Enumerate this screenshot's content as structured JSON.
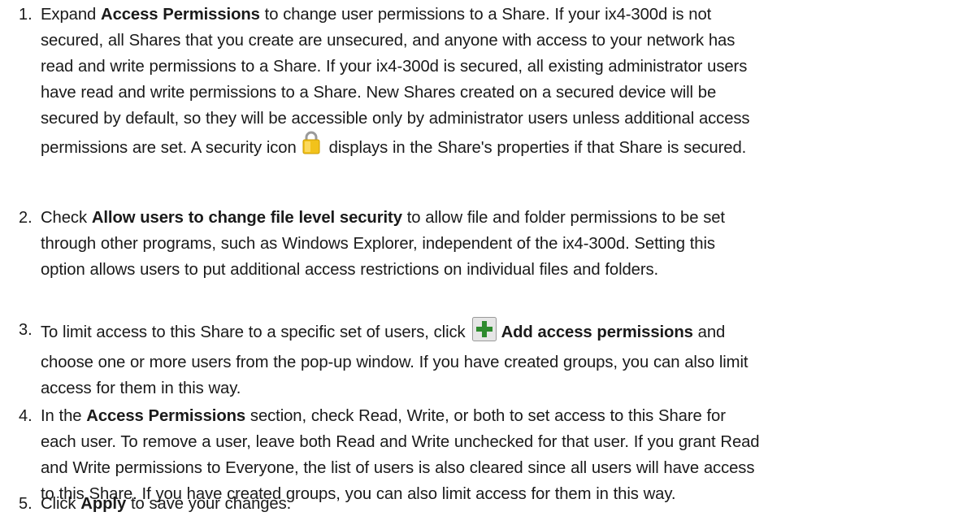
{
  "steps": [
    {
      "number": "1.",
      "lines": [
        [
          "Expand ",
          {
            "b": "Access Permissions"
          },
          " to change user permissions to a Share. If your ix4-300d is not"
        ],
        [
          "secured, all Shares that you create are unsecured, and anyone with access to your network has"
        ],
        [
          "read and write permissions to a Share. If your ix4-300d is secured, all existing administrator users"
        ],
        [
          "have read and write permissions to a Share. New Shares created on a secured device will be"
        ],
        [
          "secured by default, so they will be accessible only by administrator users unless additional access"
        ],
        [
          "permissions are set. A security icon",
          {
            "icon": "lock-icon"
          },
          "displays in the Share's properties if that Share is secured."
        ]
      ]
    },
    {
      "number": "2.",
      "lines": [
        [
          "Check ",
          {
            "b": "Allow users to change file level security"
          },
          " to allow file and folder permissions to be set"
        ],
        [
          "through other programs, such as Windows Explorer, independent of the ix4-300d. Setting this"
        ],
        [
          "option allows users to put additional access restrictions on individual files and folders."
        ]
      ]
    },
    {
      "number": "3.",
      "lines": [
        [
          "To limit access to this Share to a specific set of users, click",
          {
            "icon": "add-icon"
          },
          {
            "b": "Add access permissions"
          },
          " and"
        ],
        [
          "choose one or more users from the pop-up window. If you have created groups, you can also limit"
        ],
        [
          "access for them in this way."
        ]
      ]
    },
    {
      "number": "4.",
      "lines": [
        [
          "In the ",
          {
            "b": "Access Permissions"
          },
          " section, check Read, Write, or both to set access to this Share for"
        ],
        [
          "each user. To remove a user, leave both Read and Write unchecked for that user. If you grant Read"
        ],
        [
          "and Write permissions to Everyone, the list of users is also cleared since all users will have access"
        ],
        [
          "to this Share. If you have created groups, you can also limit access for them in this way."
        ]
      ]
    },
    {
      "number": "5.",
      "lines": [
        [
          "Click ",
          {
            "b": "Apply"
          },
          " to save your changes."
        ]
      ]
    }
  ],
  "colors": {
    "text": "#1a1a1a",
    "lock_body": "#f2c21b",
    "add_plus": "#2e8b2e",
    "add_bg": "#e6e6e6"
  }
}
